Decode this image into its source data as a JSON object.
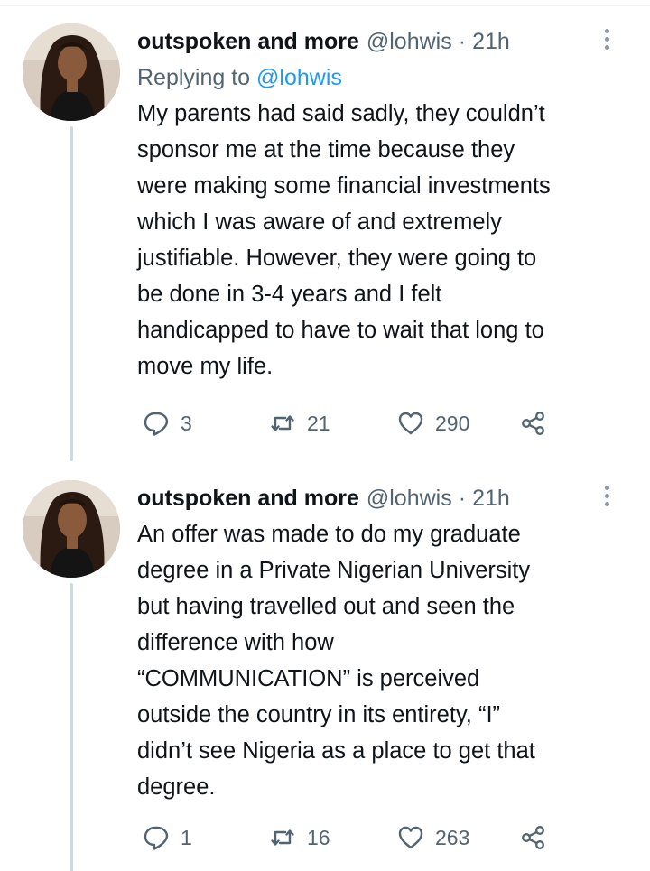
{
  "tweets": [
    {
      "author_name": "outspoken and more",
      "handle": "@lohwis",
      "separator": "·",
      "time": "21h",
      "replying_label": "Replying to",
      "replying_mention": "@lohwis",
      "text": "My parents had said sadly, they couldn’t\nsponsor me at the time because they\nwere making some financial investments\nwhich I was aware of and extremely\njustifiable. However, they were going to\nbe done in 3-4 years and I felt\nhandicapped to have to wait that long to\nmove my life.",
      "replies": "3",
      "retweets": "21",
      "likes": "290"
    },
    {
      "author_name": "outspoken and more",
      "handle": "@lohwis",
      "separator": "·",
      "time": "21h",
      "text": "An offer was made to do my graduate\ndegree in a Private Nigerian University\nbut having travelled out and seen the\ndifference with how\n“COMMUNICATION” is perceived\noutside the country in its entirety, “I”\ndidn’t see Nigeria as a place to get that\ndegree.",
      "replies": "1",
      "retweets": "16",
      "likes": "263"
    }
  ],
  "icons": {
    "reply": "reply-icon",
    "retweet": "retweet-icon",
    "like": "heart-icon",
    "share": "share-icon",
    "more": "more-icon"
  },
  "colors": {
    "text": "#0f1419",
    "secondary": "#536471",
    "link": "#1d9bf0",
    "thread_line": "#cfd9de"
  }
}
